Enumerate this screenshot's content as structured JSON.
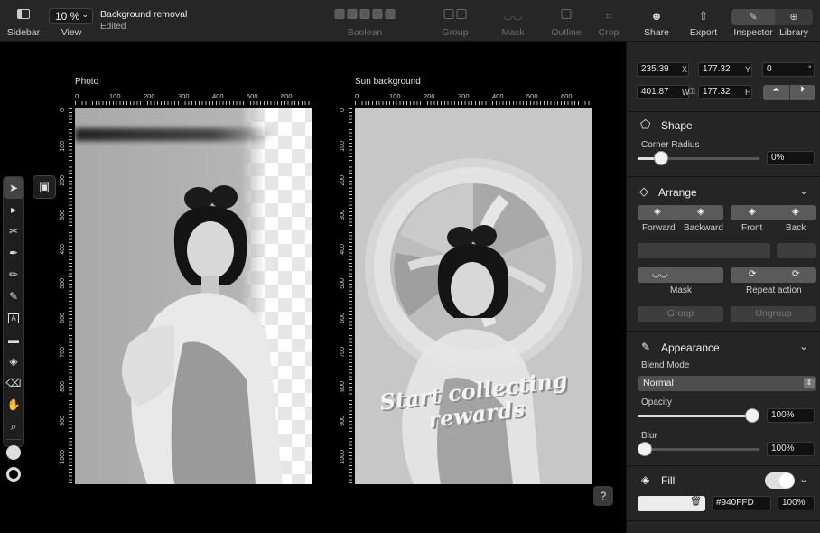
{
  "toolbar": {
    "sidebar_label": "Sidebar",
    "zoom_value": "10 %",
    "view_label": "View",
    "doc_title": "Background removal",
    "doc_status": "Edited",
    "boolean_label": "Boolean",
    "group_label": "Group",
    "mask_label": "Mask",
    "outline_label": "Outline",
    "crop_label": "Crop",
    "share_label": "Share",
    "export_label": "Export",
    "inspector_label": "Inspector",
    "library_label": "Library"
  },
  "canvas": {
    "artboard1_title": "Photo",
    "artboard2_title": "Sun background",
    "ruler_h": [
      "0",
      "100",
      "200",
      "300",
      "400",
      "500",
      "600"
    ],
    "ruler_v": [
      "0",
      "100",
      "200",
      "300",
      "400",
      "500",
      "600",
      "700",
      "800",
      "900",
      "1000"
    ],
    "promo_line1": "Start collecting",
    "promo_line2": "rewards",
    "help_label": "?"
  },
  "inspector": {
    "x": "235.39",
    "x_unit": "X",
    "y": "177.32",
    "y_unit": "Y",
    "rotation": "0",
    "rotation_unit": "°",
    "width": "401.87",
    "width_unit": "W",
    "height": "177.32",
    "height_unit": "H",
    "shape_title": "Shape",
    "corner_radius_label": "Corner Radius",
    "corner_radius_value": "0%",
    "arrange_title": "Arrange",
    "forward_label": "Forward",
    "backward_label": "Backward",
    "front_label": "Front",
    "back_label": "Back",
    "mask_label": "Mask",
    "repeat_action_label": "Repeat action",
    "group_label": "Group",
    "ungroup_label": "Ungroup",
    "appearance_title": "Appearance",
    "blend_mode_label": "Blend Mode",
    "blend_mode_value": "Normal",
    "opacity_label": "Opacity",
    "opacity_value": "100%",
    "blur_label": "Blur",
    "blur_value": "100%",
    "fill_title": "Fill",
    "fill_hex": "#940FFD",
    "fill_opacity": "100%"
  },
  "colors": {
    "accent": "#940FFD",
    "panel": "#252525",
    "canvas": "#000000"
  }
}
